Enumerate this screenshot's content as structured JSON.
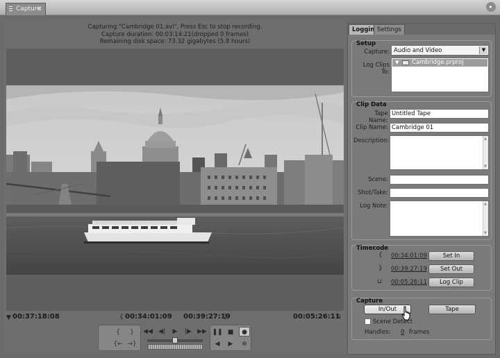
{
  "window": {
    "tab_label": "Capture",
    "close_glyph": "×",
    "menu_glyph": "▸"
  },
  "status": {
    "line1": "Capturing \"Cambridge 01.avi\", Press Esc to stop recording.",
    "line2": "Capture duration: 00:03:14:21(dropped 0 frames)",
    "line3": "Remaining disk space: 73.32 gigabytes (5.8 hours)"
  },
  "timecodes": {
    "current": "00:37:18:08",
    "in_point": "00:34:01:09",
    "out_point": "00:39:27:19",
    "duration": "00:05:26:11"
  },
  "icons": {
    "current": "▼",
    "in": "{",
    "out": "}",
    "duration": "⊔",
    "mark_in": "{",
    "mark_out": "}",
    "goto_in": "{←",
    "goto_out": "→}",
    "rewind": "◀◀",
    "step_back": "◀|",
    "play": "▶",
    "step_fwd": "|▶",
    "ffwd": "▶▶",
    "pause": "❚❚",
    "stop": "■",
    "record": "●",
    "scene_back": "◀",
    "scene_fwd": "▶",
    "capture_mode": "⊛",
    "dropdown": "▼",
    "tree_toggle": "▼"
  },
  "tabs": {
    "logging": "Logging",
    "settings": "Settings"
  },
  "setup": {
    "title": "Setup",
    "capture_label": "Capture:",
    "capture_value": "Audio and Video",
    "log_clips_label": "Log Clips To:",
    "project": "Cambridge.prproj"
  },
  "clip_data": {
    "title": "Clip Data",
    "tape_name_label": "Tape Name:",
    "tape_name": "Untitled Tape",
    "clip_name_label": "Clip Name:",
    "clip_name": "Cambridge 01",
    "description_label": "Description:",
    "scene_label": "Scene:",
    "shot_take_label": "Shot/Take:",
    "log_note_label": "Log Note:"
  },
  "timecode_section": {
    "title": "Timecode",
    "in": "00:34:01:09",
    "out": "00:39:27:19",
    "duration": "00:05:26:11",
    "set_in": "Set In",
    "set_out": "Set Out",
    "log_clip": "Log Clip"
  },
  "capture_section": {
    "title": "Capture",
    "in_out": "In/Out",
    "tape": "Tape",
    "scene_detect": "Scene Detect",
    "handles_label": "Handles:",
    "handles_value": "0",
    "handles_unit": "frames"
  }
}
